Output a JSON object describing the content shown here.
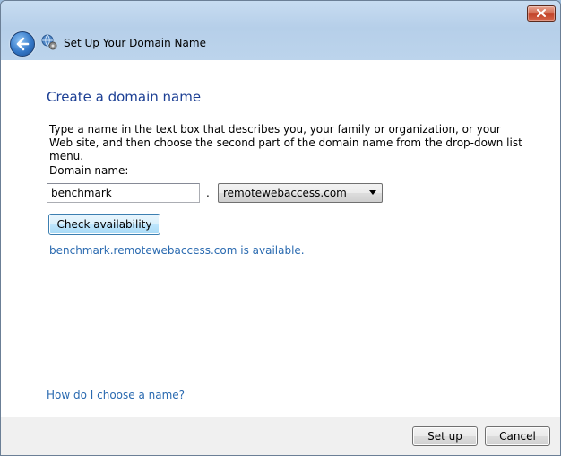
{
  "window": {
    "title": "Set Up Your Domain Name",
    "accent_color": "#1c3f94",
    "link_color": "#2a6ab0"
  },
  "icons": {
    "close": "close-icon",
    "back": "back-arrow-icon",
    "app": "domain-globe-icon",
    "dropdown": "chevron-down-icon"
  },
  "main": {
    "heading": "Create a domain name",
    "description": "Type a name in the text box that describes you, your family or organization, or your Web site, and then choose the second part of the domain name from the drop-down list menu.",
    "domain_label": "Domain name:",
    "domain_value": "benchmark",
    "separator": ".",
    "suffix_selected": "remotewebaccess.com",
    "check_button": "Check availability",
    "availability_message": "benchmark.remotewebaccess.com is available.",
    "help_link": "How do I choose a name?"
  },
  "footer": {
    "setup_button": "Set up",
    "cancel_button": "Cancel"
  }
}
